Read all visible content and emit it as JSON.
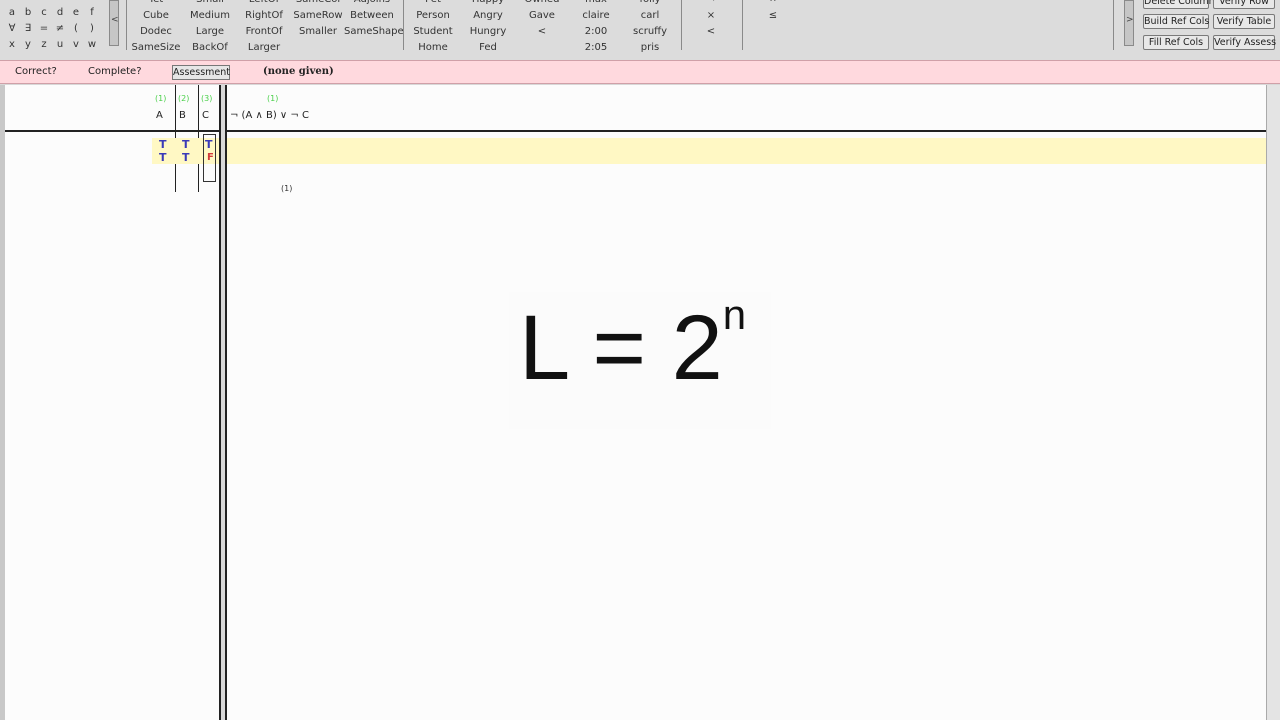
{
  "toolbar": {
    "symbols": [
      [
        "a",
        "b",
        "c",
        "d",
        "e",
        "f"
      ],
      [
        "∀",
        "∃",
        "=",
        "≠",
        "(",
        ")"
      ],
      [
        "x",
        "y",
        "z",
        "u",
        "v",
        "w"
      ]
    ],
    "word_columns": [
      [
        "Tet",
        "Cube",
        "Dodec",
        "SameSize"
      ],
      [
        "Small",
        "Medium",
        "Large",
        "BackOf"
      ],
      [
        "LeftOf",
        "RightOf",
        "FrontOf",
        "Larger"
      ],
      [
        "SameCol",
        "SameRow",
        "Smaller",
        ""
      ],
      [
        "Adjoins",
        "Between",
        "SameShape",
        ""
      ],
      [
        "Pet",
        "Person",
        "Student",
        "Home"
      ],
      [
        "Happy",
        "Angry",
        "Hungry",
        "Fed"
      ],
      [
        "Owned",
        "Gave",
        "<",
        ""
      ],
      [
        "max",
        "claire",
        "2:00",
        "2:05"
      ],
      [
        "folly",
        "carl",
        "scruffy",
        "pris"
      ]
    ],
    "op_columns": [
      [
        "¬",
        "×",
        "<"
      ],
      [
        "↔",
        "≤",
        ""
      ]
    ],
    "buttons": {
      "delete_column": "Delete Column",
      "verify_row": "Verify Row",
      "build_ref_cols": "Build Ref Cols",
      "verify_table": "Verify Table",
      "fill_ref_cols": "Fill Ref Cols",
      "verify_assess": "Verify Assess"
    }
  },
  "assessment": {
    "correct_label": "Correct?",
    "complete_label": "Complete?",
    "button_label": "Assessment",
    "value": "(none given)"
  },
  "truth_table": {
    "ref_columns": [
      {
        "num": "(1)",
        "name": "A"
      },
      {
        "num": "(2)",
        "name": "B"
      },
      {
        "num": "(3)",
        "name": "C"
      }
    ],
    "formula_column": {
      "num": "(1)",
      "formula": "¬ (A ∧ B) ∨ ¬ C"
    },
    "rows": [
      {
        "A": "T",
        "B": "T",
        "C": "T"
      },
      {
        "A": "T",
        "B": "T",
        "C": "F"
      }
    ],
    "main_connective_marker": "(1)"
  },
  "overlay": {
    "lhs": "L = 2",
    "exponent": "n"
  },
  "colors": {
    "assessment_bar": "#ffd9de",
    "highlight_row": "#fff8c4",
    "truth_value": "#3a3ab8",
    "false_value": "#d23a3a",
    "column_number": "#4bd04b"
  }
}
